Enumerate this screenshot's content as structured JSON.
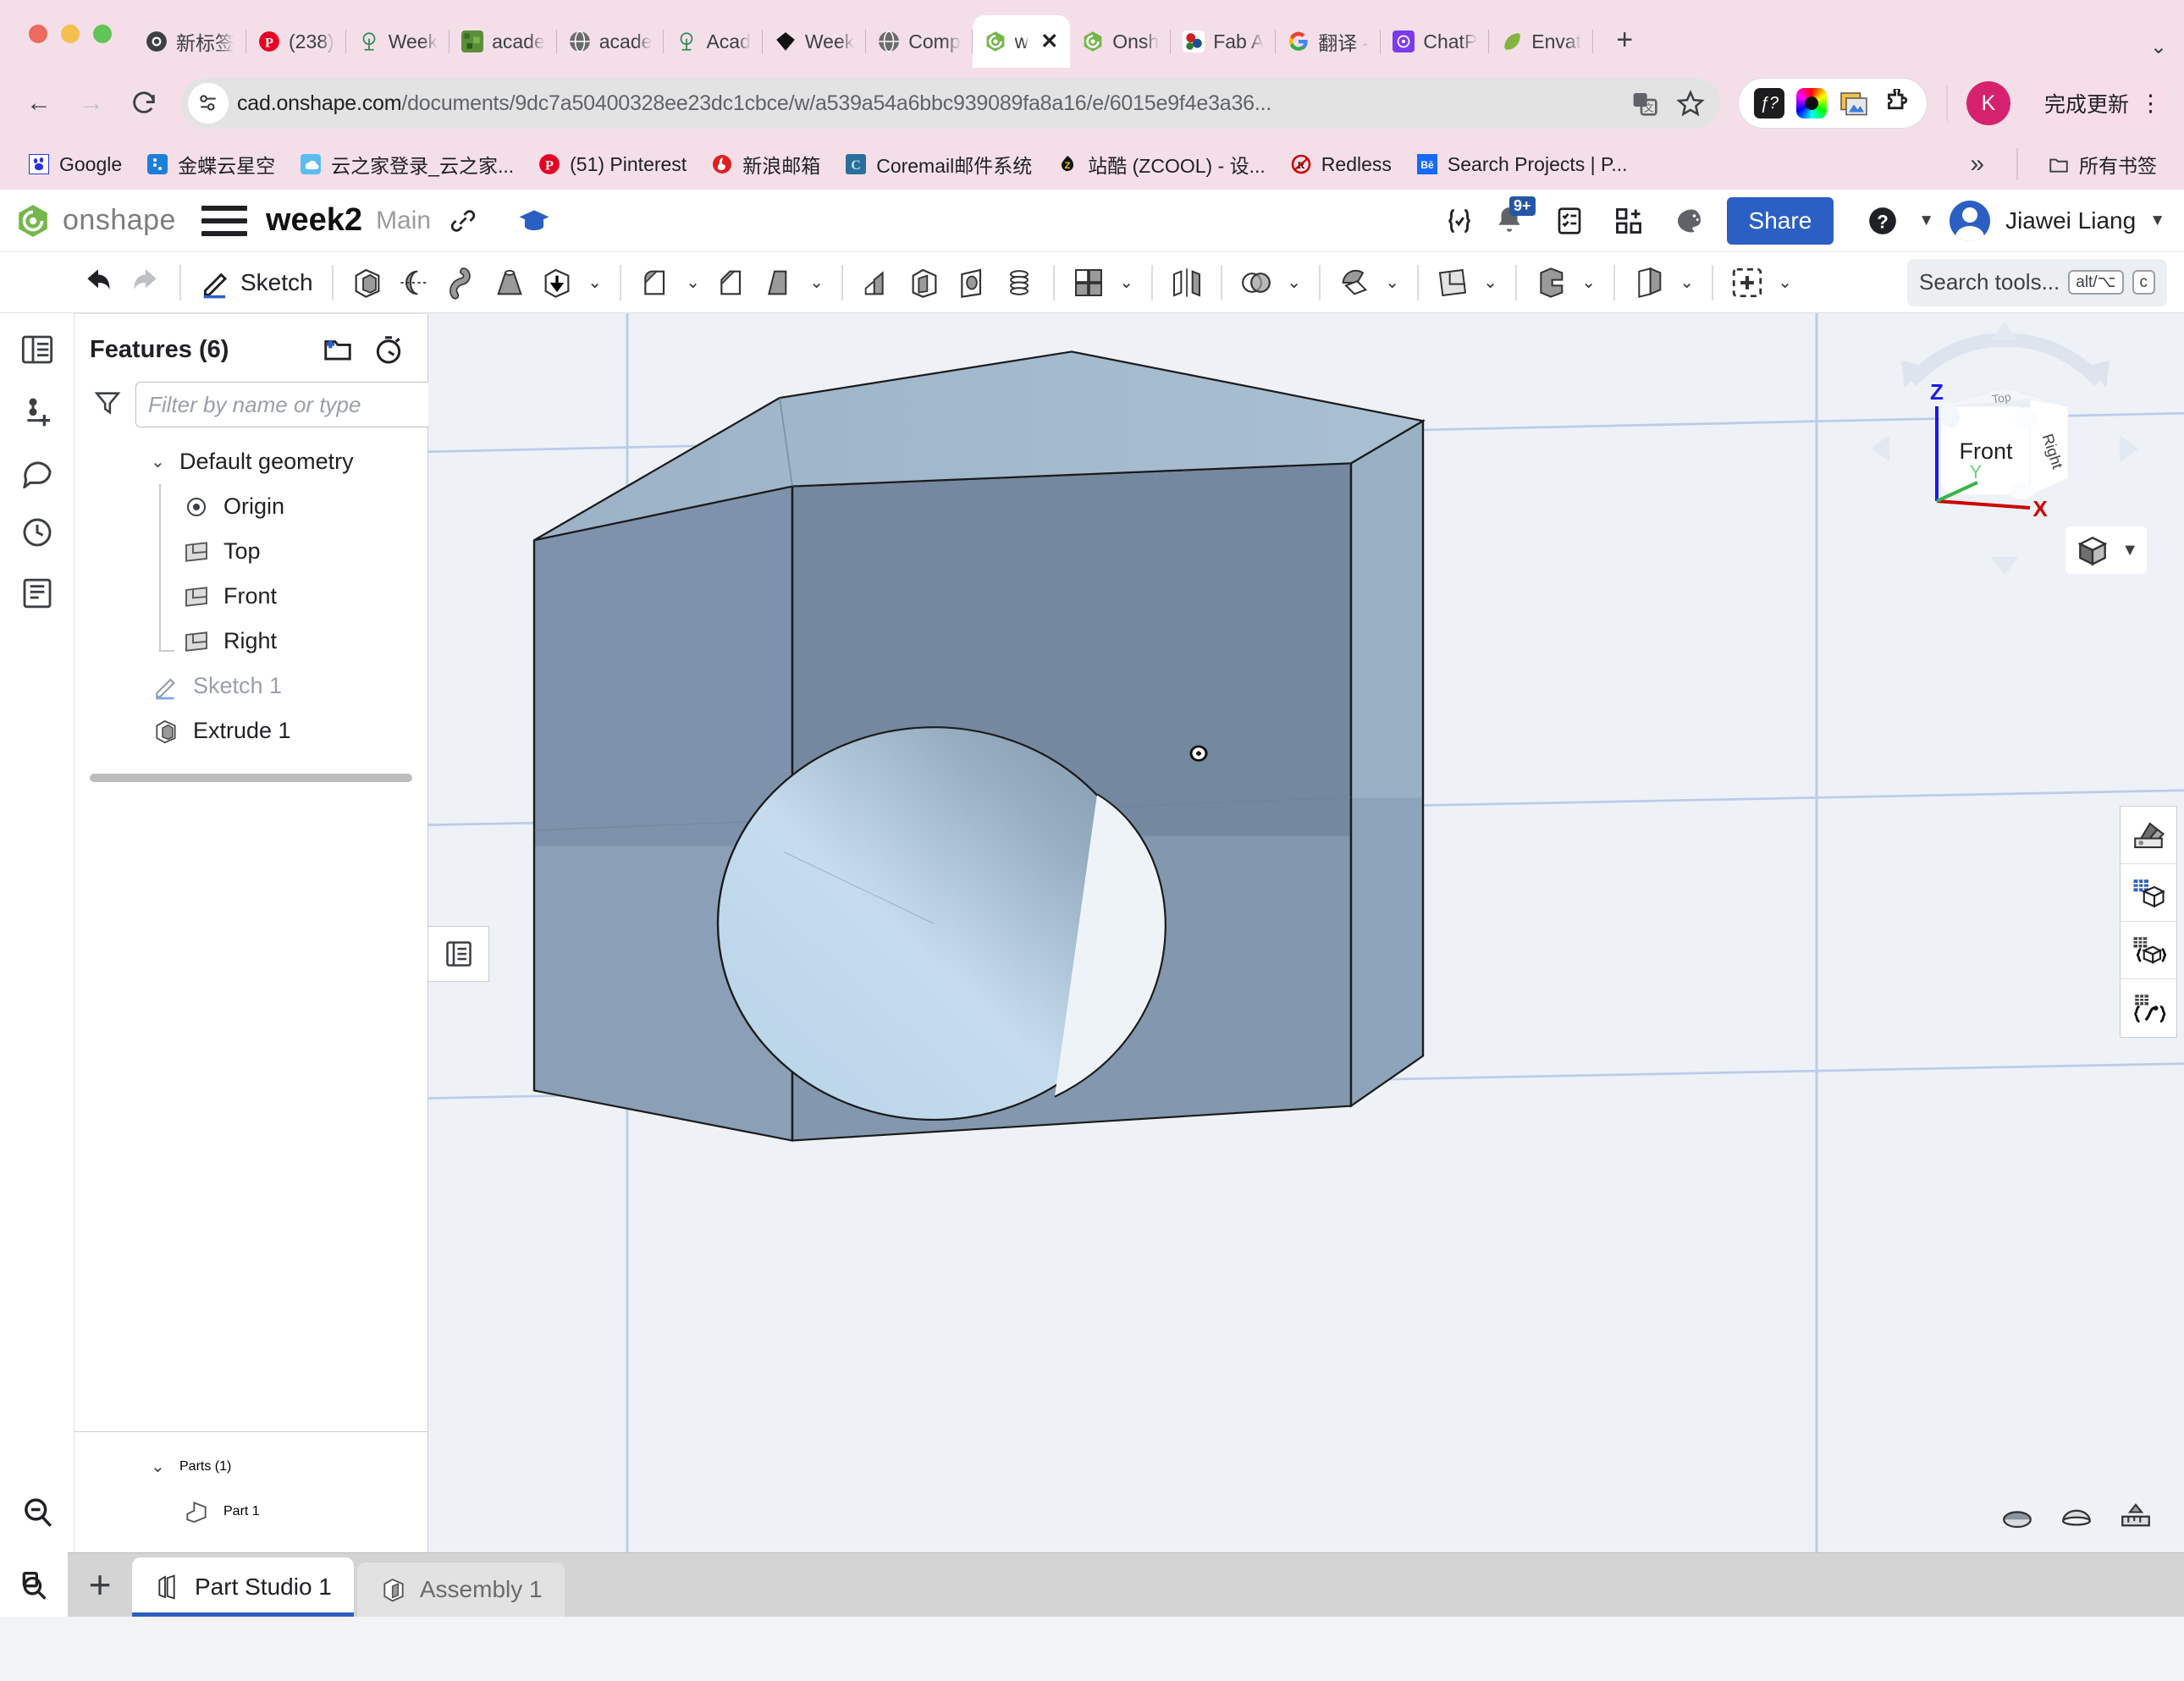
{
  "browser": {
    "tabs": [
      {
        "label": "新标签",
        "icon": "chrome-icon",
        "active": false
      },
      {
        "label": "(238)",
        "icon": "pinterest-icon",
        "active": false
      },
      {
        "label": "Week",
        "icon": "tree-icon",
        "active": false
      },
      {
        "label": "acade",
        "icon": "minecraft-icon",
        "active": false
      },
      {
        "label": "acade",
        "icon": "globe-icon",
        "active": false
      },
      {
        "label": "Acad",
        "icon": "tree-icon",
        "active": false
      },
      {
        "label": "Week",
        "icon": "diamond-icon",
        "active": false
      },
      {
        "label": "Comp",
        "icon": "globe-icon",
        "active": false
      },
      {
        "label": "w",
        "icon": "onshape-icon",
        "active": true
      },
      {
        "label": "Onsh",
        "icon": "onshape-icon",
        "active": false
      },
      {
        "label": "Fab A",
        "icon": "fab-icon",
        "active": false
      },
      {
        "label": "翻译 -",
        "icon": "google-icon",
        "active": false
      },
      {
        "label": "ChatP",
        "icon": "chatpdf-icon",
        "active": false
      },
      {
        "label": "Envat",
        "icon": "envato-icon",
        "active": false
      }
    ],
    "new_tab_label": "+",
    "close_label": "✕",
    "nav": {
      "back": "←",
      "forward": "→",
      "reload": "⟳"
    },
    "url_host": "cad.onshape.com",
    "url_path": "/documents/9dc7a50400328ee23dc1cbce/w/a539a54a6bbc939089fa8a16/e/6015e9f4e3a36...",
    "translate_icon": "translate-icon",
    "bookmark_star": "☆",
    "extensions": [
      "fx-extension-icon",
      "color-picker-extension-icon",
      "image-extension-icon",
      "puzzle-extension-icon"
    ],
    "profile_initial": "K",
    "update_label": "完成更新",
    "bookmarks": [
      {
        "label": "Google",
        "icon": "baidu-icon"
      },
      {
        "label": "金蝶云星空",
        "icon": "kingdee-icon"
      },
      {
        "label": "云之家登录_云之家...",
        "icon": "yunzhijia-icon"
      },
      {
        "label": "(51) Pinterest",
        "icon": "pinterest-icon"
      },
      {
        "label": "新浪邮箱",
        "icon": "sina-icon"
      },
      {
        "label": "Coremail邮件系统",
        "icon": "coremail-icon"
      },
      {
        "label": "站酷 (ZCOOL) - 设...",
        "icon": "zcool-icon"
      },
      {
        "label": "Redless",
        "icon": "redless-icon"
      },
      {
        "label": "Search Projects | P...",
        "icon": "behance-icon"
      }
    ],
    "bookmarks_overflow": "»",
    "all_bookmarks_label": "所有书签"
  },
  "onshape": {
    "brand": "onshape",
    "document_title": "week2",
    "branch": "Main",
    "header_icons": [
      "link-icon",
      "graduation-cap-icon",
      "braces-check-icon",
      "bell-icon",
      "checklist-icon",
      "add-panel-icon",
      "brain-icon"
    ],
    "notification_badge": "9+",
    "share_label": "Share",
    "help_icon": "help-icon",
    "user_name": "Jiawei Liang",
    "toolbar": {
      "undo": "undo-icon",
      "redo": "redo-icon",
      "sketch_label": "Sketch",
      "tools": [
        "extrude-icon",
        "revolve-icon",
        "sweep-icon",
        "loft-icon",
        "thicken-icon",
        "fillet-icon",
        "chamfer-icon",
        "draft-icon",
        "rib-icon",
        "shell-icon",
        "hole-icon",
        "helix-icon",
        "pattern-icon",
        "mirror-icon",
        "boolean-icon",
        "split-icon",
        "transform-icon",
        "enclose-icon",
        "move-face-icon",
        "insert-icon"
      ],
      "search_placeholder": "Search tools...",
      "kbd_modifier": "alt/⌥",
      "kbd_key": "c"
    },
    "features_panel": {
      "title": "Features (6)",
      "add_folder_icon": "add-folder-icon",
      "rollback_icon": "stopwatch-icon",
      "filter_icon": "filter-icon",
      "filter_placeholder": "Filter by name or type",
      "group_label": "Default geometry",
      "items": [
        {
          "label": "Origin",
          "icon": "origin-icon",
          "dim": false
        },
        {
          "label": "Top",
          "icon": "plane-icon",
          "dim": false
        },
        {
          "label": "Front",
          "icon": "plane-icon",
          "dim": false
        },
        {
          "label": "Right",
          "icon": "plane-icon",
          "dim": false
        }
      ],
      "features": [
        {
          "label": "Sketch 1",
          "icon": "sketch-icon",
          "dim": true
        },
        {
          "label": "Extrude 1",
          "icon": "extrude-icon",
          "dim": false
        }
      ],
      "parts_title": "Parts (1)",
      "parts": [
        {
          "label": "Part 1",
          "icon": "part-icon"
        }
      ]
    },
    "viewcube": {
      "front_label": "Front",
      "right_label": "Right",
      "top_label": "Top",
      "axis_z": "Z",
      "axis_y": "Y",
      "axis_x": "X",
      "axis_z_color": "#1a1aee",
      "axis_y_color": "#3ab54a",
      "axis_x_color": "#cc0000"
    },
    "right_tools": [
      "appearance-icon",
      "display-grid-icon",
      "render-braces-icon",
      "render-curve-icon"
    ],
    "bottom_icons": [
      "view-section-icon",
      "view-shade-icon",
      "view-measure-icon"
    ],
    "sheet_tabs": [
      {
        "label": "Part Studio 1",
        "icon": "part-studio-icon",
        "active": true
      },
      {
        "label": "Assembly 1",
        "icon": "assembly-icon",
        "active": false
      }
    ],
    "add_tab_label": "+",
    "tab_search_icon": "tab-search-icon"
  },
  "colors": {
    "accent_blue": "#2c5fc3",
    "chrome_pink": "#f4dfe9",
    "model_front": "#7f94ac",
    "model_top": "#9ab2c8",
    "model_side": "#8ca3ba",
    "graphics_bg": "#eef1f6",
    "gridline": "#b9cde8"
  }
}
